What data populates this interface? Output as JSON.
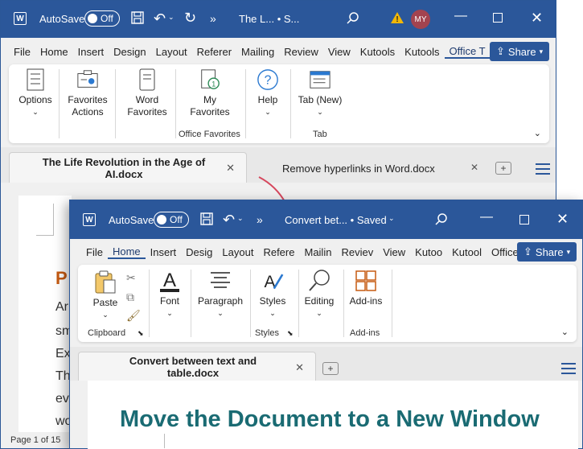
{
  "back_window": {
    "autosave_label": "AutoSave",
    "autosave_state": "Off",
    "title": "The L... • S...",
    "overflow": "»",
    "avatar_initials": "MY",
    "share_label": "Share",
    "tabs": [
      "File",
      "Home",
      "Insert",
      "Design",
      "Layout",
      "Referer",
      "Mailing",
      "Review",
      "View",
      "Kutools",
      "Kutools",
      "Office T"
    ],
    "active_tab_index": 11,
    "ribbon": {
      "options": "Options",
      "favorites_actions": "Favorites\nActions",
      "word_favorites": "Word\nFavorites",
      "my_favorites": "My\nFavorites",
      "office_favorites_group": "Office Favorites",
      "help": "Help",
      "tab_new": "Tab (New)",
      "tab_group": "Tab"
    },
    "doc_tabs": [
      {
        "label": "The Life Revolution in the Age of AI.docx"
      },
      {
        "label": "Remove hyperlinks in Word.docx"
      }
    ],
    "page_letters": [
      "P",
      "Ar",
      "sm",
      "Ex",
      "Th",
      "ev",
      "wo"
    ],
    "status": "Page 1 of 15"
  },
  "front_window": {
    "autosave_label": "AutoSave",
    "autosave_state": "Off",
    "title": "Convert bet... • Saved",
    "overflow": "»",
    "share_label": "Share",
    "tabs": [
      "File",
      "Home",
      "Insert",
      "Desig",
      "Layout",
      "Refere",
      "Mailin",
      "Reviev",
      "View",
      "Kutoo",
      "Kutool",
      "Office"
    ],
    "active_tab_index": 1,
    "ribbon": {
      "paste": "Paste",
      "clipboard_group": "Clipboard",
      "font": "Font",
      "paragraph": "Paragraph",
      "styles": "Styles",
      "styles_group": "Styles",
      "editing": "Editing",
      "addins": "Add-ins",
      "addins_group": "Add-ins"
    },
    "doc_tab": "Convert between text and table.docx",
    "heading": "Move the Document to a New Window"
  },
  "colors": {
    "title_blue": "#2b579a",
    "heading_teal": "#1a6b73",
    "arrow_red": "#d6475d",
    "accent_orange": "#c55a11"
  }
}
